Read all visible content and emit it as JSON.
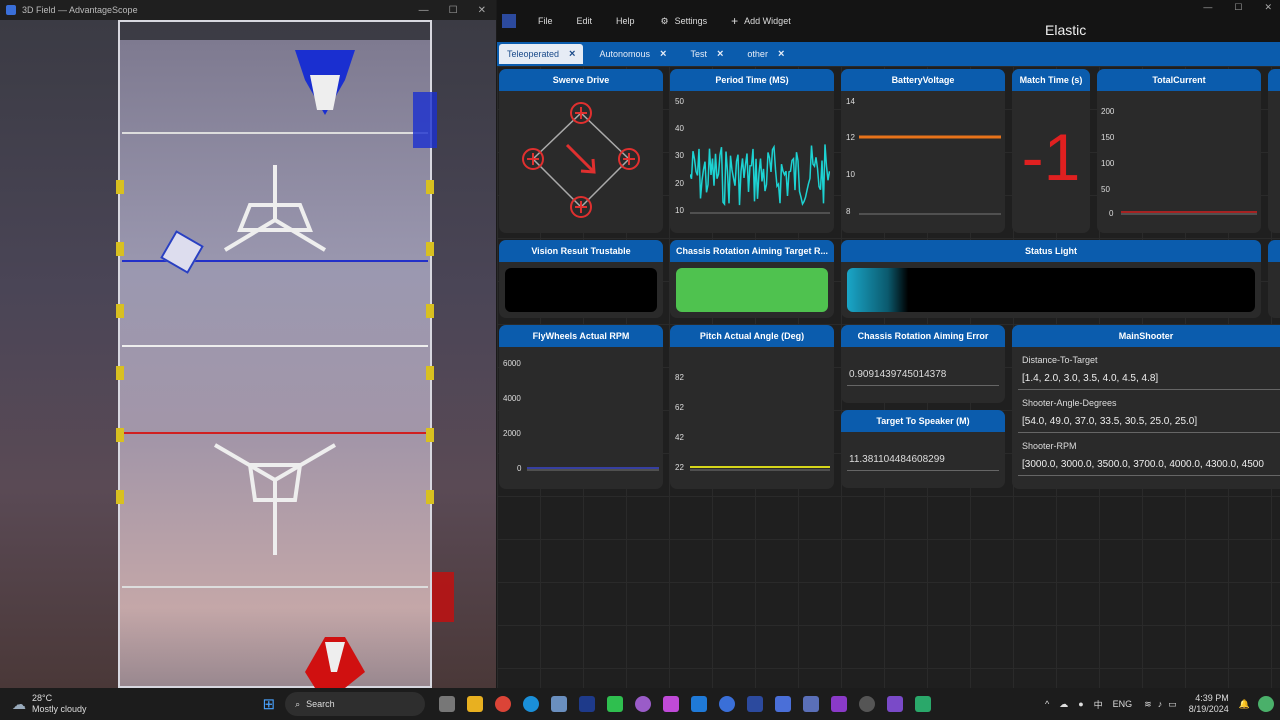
{
  "advantagescope": {
    "title": "3D Field — AdvantageScope"
  },
  "elastic": {
    "menu": {
      "file": "File",
      "edit": "Edit",
      "help": "Help",
      "settings": "Settings",
      "add_widget": "Add Widget"
    },
    "title": "Elastic",
    "tabs": [
      {
        "label": "Teleoperated",
        "active": true
      },
      {
        "label": "Autonomous",
        "active": false
      },
      {
        "label": "Test",
        "active": false
      },
      {
        "label": "other",
        "active": false
      }
    ],
    "widgets": {
      "swerve": {
        "title": "Swerve Drive"
      },
      "period": {
        "title": "Period Time (MS)",
        "ticks": [
          "50",
          "40",
          "30",
          "20",
          "10"
        ]
      },
      "battery": {
        "title": "BatteryVoltage",
        "ticks": [
          "14",
          "12",
          "10",
          "8"
        ],
        "line_color": "#e8731a"
      },
      "match_time": {
        "title": "Match Time (s)",
        "value": "-1"
      },
      "total_current": {
        "title": "TotalCurrent",
        "ticks": [
          "200",
          "150",
          "100",
          "50",
          "0"
        ]
      },
      "vision": {
        "title": "Vision Result Trustable",
        "color": "#000000"
      },
      "chassis_target": {
        "title": "Chassis Rotation Aiming Target R...",
        "color": "#4fc24f"
      },
      "status_light": {
        "title": "Status Light"
      },
      "flywheels": {
        "title": "FlyWheels Actual RPM",
        "ticks": [
          "6000",
          "4000",
          "2000",
          "0"
        ]
      },
      "pitch": {
        "title": "Pitch Actual Angle (Deg)",
        "ticks": [
          "82",
          "62",
          "42",
          "22"
        ],
        "line_color": "#d6d61a"
      },
      "chassis_error": {
        "title": "Chassis Rotation Aiming Error",
        "value": "0.9091439745014378"
      },
      "target_speaker": {
        "title": "Target To Speaker (M)",
        "value": "11.381104484608299"
      },
      "main_shooter": {
        "title": "MainShooter",
        "entries": [
          {
            "label": "Distance-To-Target",
            "value": "[1.4, 2.0, 3.0, 3.5, 4.0, 4.5, 4.8]"
          },
          {
            "label": "Shooter-Angle-Degrees",
            "value": "[54.0, 49.0, 37.0, 33.5, 30.5, 25.0, 25.0]"
          },
          {
            "label": "Shooter-RPM",
            "value": "[3000.0, 3000.0, 3500.0, 3700.0, 4000.0, 4300.0, 4500"
          }
        ]
      }
    }
  },
  "taskbar": {
    "weather_temp": "28°C",
    "weather_desc": "Mostly cloudy",
    "search_placeholder": "Search",
    "lang": "ENG",
    "time": "4:39 PM",
    "date": "8/19/2024"
  }
}
